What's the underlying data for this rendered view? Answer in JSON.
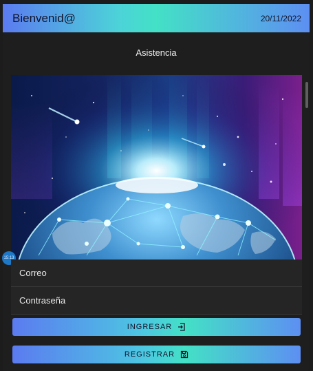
{
  "header": {
    "title": "Bienvenid@",
    "date": "20/11/2022"
  },
  "page": {
    "subtitle": "Asistencia"
  },
  "hero": {
    "icon": "globe-network-image"
  },
  "form": {
    "email_label": "Correo",
    "password_label": "Contraseña"
  },
  "buttons": {
    "login_label": "INGRESAR",
    "login_icon": "login-icon",
    "register_label": "REGISTRAR",
    "register_icon": "save-icon"
  },
  "overlay": {
    "badge_text": "15:13"
  },
  "colors": {
    "gradient_start": "#5b7bf0",
    "gradient_mid": "#43e1c6",
    "gradient_end": "#5d8ff2",
    "background": "#1e1e1e"
  }
}
